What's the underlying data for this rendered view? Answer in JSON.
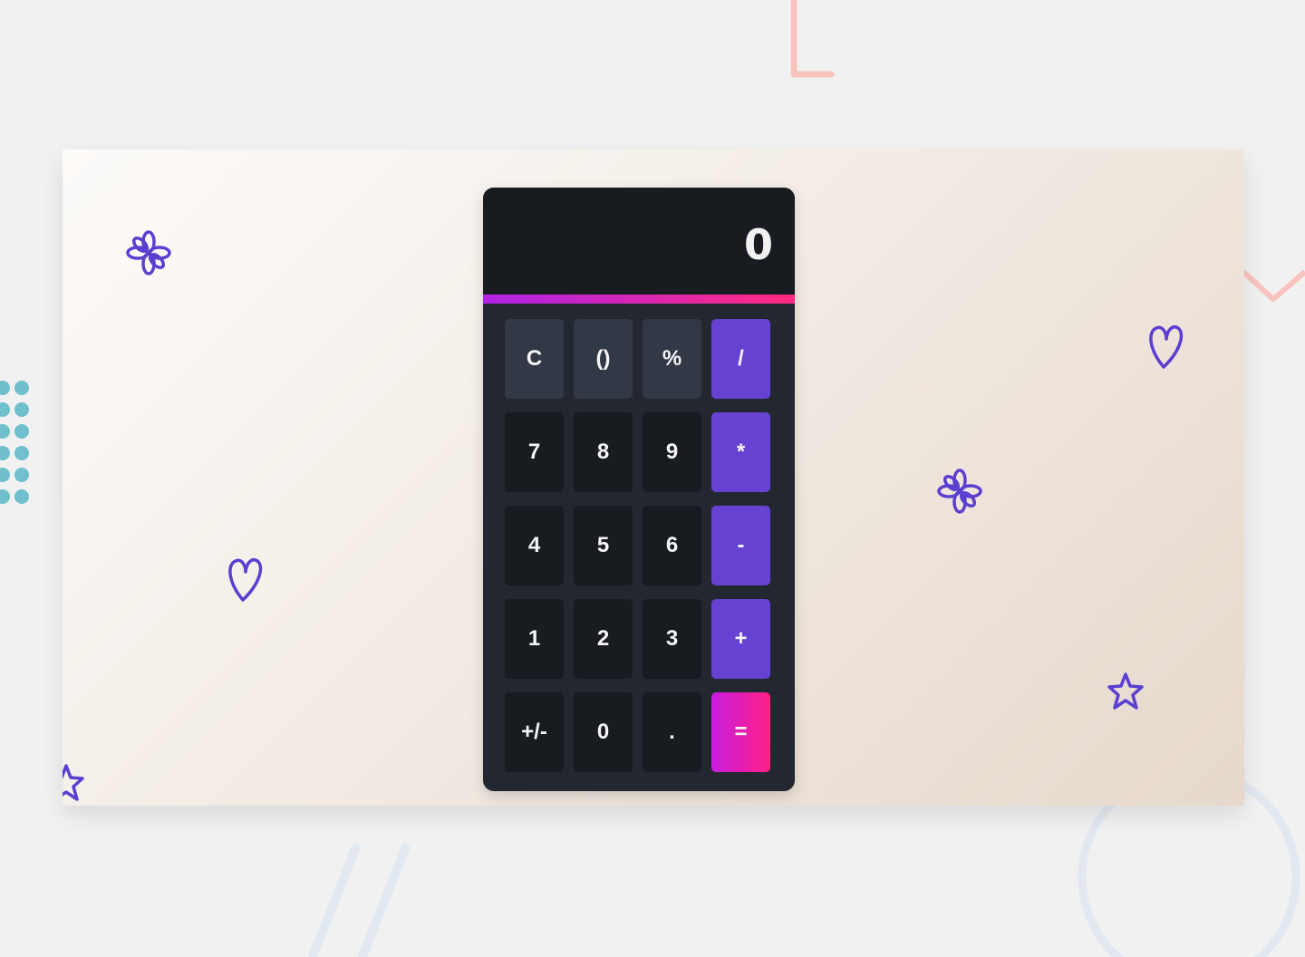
{
  "calculator": {
    "display_value": "0",
    "keys": [
      {
        "label": "C",
        "name": "key-clear",
        "kind": "fn"
      },
      {
        "label": "()",
        "name": "key-parentheses",
        "kind": "fn"
      },
      {
        "label": "%",
        "name": "key-percent",
        "kind": "fn"
      },
      {
        "label": "/",
        "name": "key-divide",
        "kind": "op"
      },
      {
        "label": "7",
        "name": "key-7",
        "kind": "num"
      },
      {
        "label": "8",
        "name": "key-8",
        "kind": "num"
      },
      {
        "label": "9",
        "name": "key-9",
        "kind": "num"
      },
      {
        "label": "*",
        "name": "key-multiply",
        "kind": "op"
      },
      {
        "label": "4",
        "name": "key-4",
        "kind": "num"
      },
      {
        "label": "5",
        "name": "key-5",
        "kind": "num"
      },
      {
        "label": "6",
        "name": "key-6",
        "kind": "num"
      },
      {
        "label": "-",
        "name": "key-subtract",
        "kind": "op"
      },
      {
        "label": "1",
        "name": "key-1",
        "kind": "num"
      },
      {
        "label": "2",
        "name": "key-2",
        "kind": "num"
      },
      {
        "label": "3",
        "name": "key-3",
        "kind": "num"
      },
      {
        "label": "+",
        "name": "key-add",
        "kind": "op"
      },
      {
        "label": "+/-",
        "name": "key-negate",
        "kind": "num"
      },
      {
        "label": "0",
        "name": "key-0",
        "kind": "num"
      },
      {
        "label": ".",
        "name": "key-decimal",
        "kind": "num"
      },
      {
        "label": "=",
        "name": "key-equals",
        "kind": "eq"
      }
    ]
  },
  "decorations": {
    "icons": [
      "flower-icon",
      "heart-icon",
      "star-icon",
      "flower-icon",
      "heart-icon",
      "star-icon",
      "star-icon"
    ],
    "colors": {
      "icon": "#5a3fd0",
      "operator": "#6542d2",
      "accent_start": "#b023e8",
      "accent_end": "#ff2b7f",
      "dots": "#6fbfcc",
      "coral": "#f9c3bd"
    }
  }
}
